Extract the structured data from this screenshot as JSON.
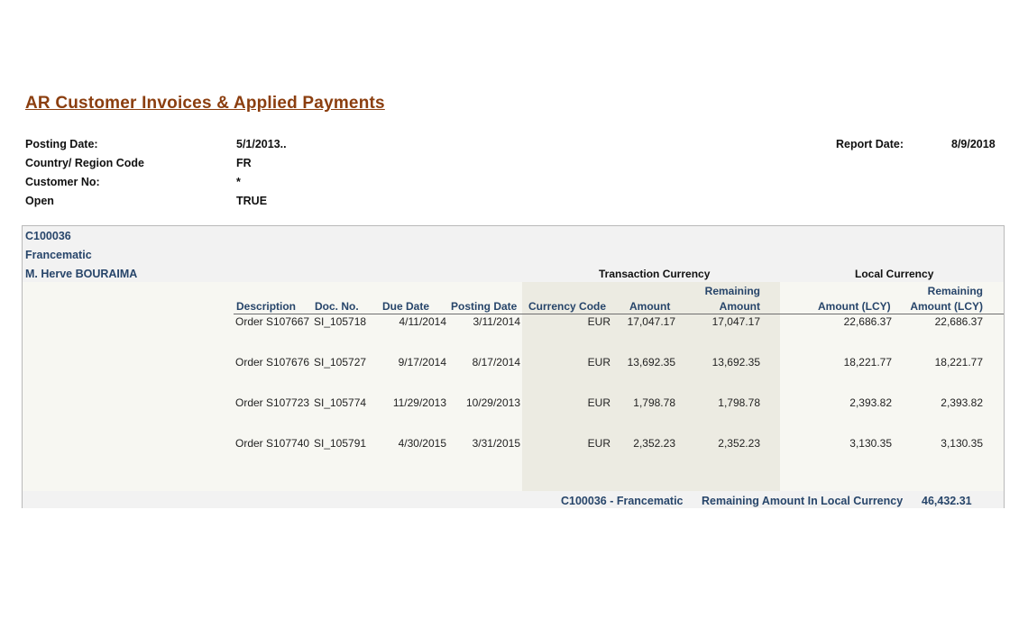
{
  "report": {
    "title": "AR Customer Invoices & Applied Payments",
    "filters": [
      {
        "label": "Posting Date:",
        "value": "5/1/2013.."
      },
      {
        "label": "Country/ Region Code",
        "value": "FR"
      },
      {
        "label": "Customer No:",
        "value": "*"
      },
      {
        "label": "Open",
        "value": "TRUE"
      }
    ],
    "report_date_label": "Report Date:",
    "report_date_value": "8/9/2018"
  },
  "customer": {
    "number": "C100036",
    "name": "Francematic",
    "contact": "M. Herve BOURAIMA"
  },
  "groups": {
    "transaction": "Transaction Currency",
    "local": "Local Currency"
  },
  "columns": {
    "description": "Description",
    "doc_no": "Doc. No.",
    "due_date": "Due Date",
    "posting_date": "Posting Date",
    "currency_code": "Currency Code",
    "amount": "Amount",
    "remaining_1": "Remaining",
    "remaining_2": "Amount",
    "amount_lcy": "Amount (LCY)",
    "remaining_lcy_1": "Remaining",
    "remaining_lcy_2": "Amount (LCY)"
  },
  "rows": [
    {
      "description": "Order S107667",
      "doc_no": "SI_105718",
      "due_date": "4/11/2014",
      "posting_date": "3/11/2014",
      "currency": "EUR",
      "amount": "17,047.17",
      "remaining": "17,047.17",
      "amount_lcy": "22,686.37",
      "remaining_lcy": "22,686.37"
    },
    {
      "description": "Order S107676",
      "doc_no": "SI_105727",
      "due_date": "9/17/2014",
      "posting_date": "8/17/2014",
      "currency": "EUR",
      "amount": "13,692.35",
      "remaining": "13,692.35",
      "amount_lcy": "18,221.77",
      "remaining_lcy": "18,221.77"
    },
    {
      "description": "Order S107723",
      "doc_no": "SI_105774",
      "due_date": "11/29/2013",
      "posting_date": "10/29/2013",
      "currency": "EUR",
      "amount": "1,798.78",
      "remaining": "1,798.78",
      "amount_lcy": "2,393.82",
      "remaining_lcy": "2,393.82"
    },
    {
      "description": "Order S107740",
      "doc_no": "SI_105791",
      "due_date": "4/30/2015",
      "posting_date": "3/31/2015",
      "currency": "EUR",
      "amount": "2,352.23",
      "remaining": "2,352.23",
      "amount_lcy": "3,130.35",
      "remaining_lcy": "3,130.35"
    }
  ],
  "footer": {
    "customer_label": "C100036 - Francematic",
    "total_label": "Remaining Amount  In Local Currency",
    "total_value": "46,432.31"
  }
}
